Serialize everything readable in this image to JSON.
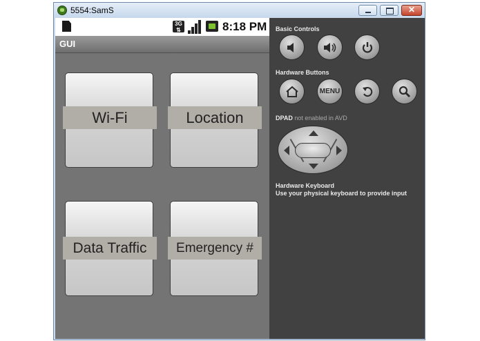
{
  "window": {
    "title": "5554:SamS"
  },
  "statusbar": {
    "network": "3G",
    "time": "8:18 PM"
  },
  "app": {
    "title": "GUI",
    "tiles": [
      {
        "label": "Wi-Fi"
      },
      {
        "label": "Location"
      },
      {
        "label": "Data Traffic"
      },
      {
        "label": "Emergency #"
      }
    ]
  },
  "panel": {
    "basic_controls": "Basic Controls",
    "hardware_buttons": "Hardware Buttons",
    "menu_label": "MENU",
    "dpad_title": "DPAD",
    "dpad_note": "not enabled in AVD",
    "keyboard_title": "Hardware Keyboard",
    "keyboard_note": "Use your physical keyboard to provide input"
  },
  "colors": {
    "screen_bg": "#747474",
    "panel_bg": "#414141",
    "tile_label_bg": "#b1aea8"
  }
}
